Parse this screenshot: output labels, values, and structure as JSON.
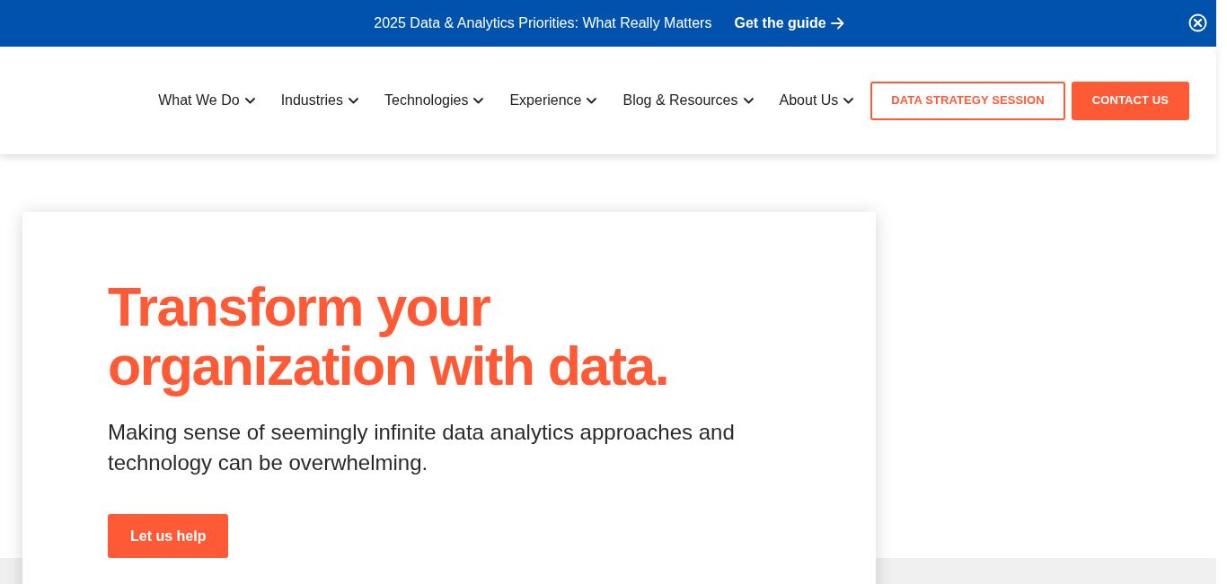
{
  "banner": {
    "text": "2025 Data & Analytics Priorities: What Really Matters",
    "link": "Get the guide"
  },
  "nav": {
    "items": [
      {
        "label": "What We Do"
      },
      {
        "label": "Industries"
      },
      {
        "label": "Technologies"
      },
      {
        "label": "Experience"
      },
      {
        "label": "Blog & Resources"
      },
      {
        "label": "About Us"
      }
    ],
    "buttons": [
      {
        "label": "DATA STRATEGY SESSION",
        "kind": "outline"
      },
      {
        "label": "CONTACT US",
        "kind": "solid"
      }
    ]
  },
  "hero": {
    "heading": "Transform your organization with data.",
    "text": "Making sense of seemingly infinite data analytics approaches and technology can be overwhelming.",
    "button": "Let us help"
  }
}
